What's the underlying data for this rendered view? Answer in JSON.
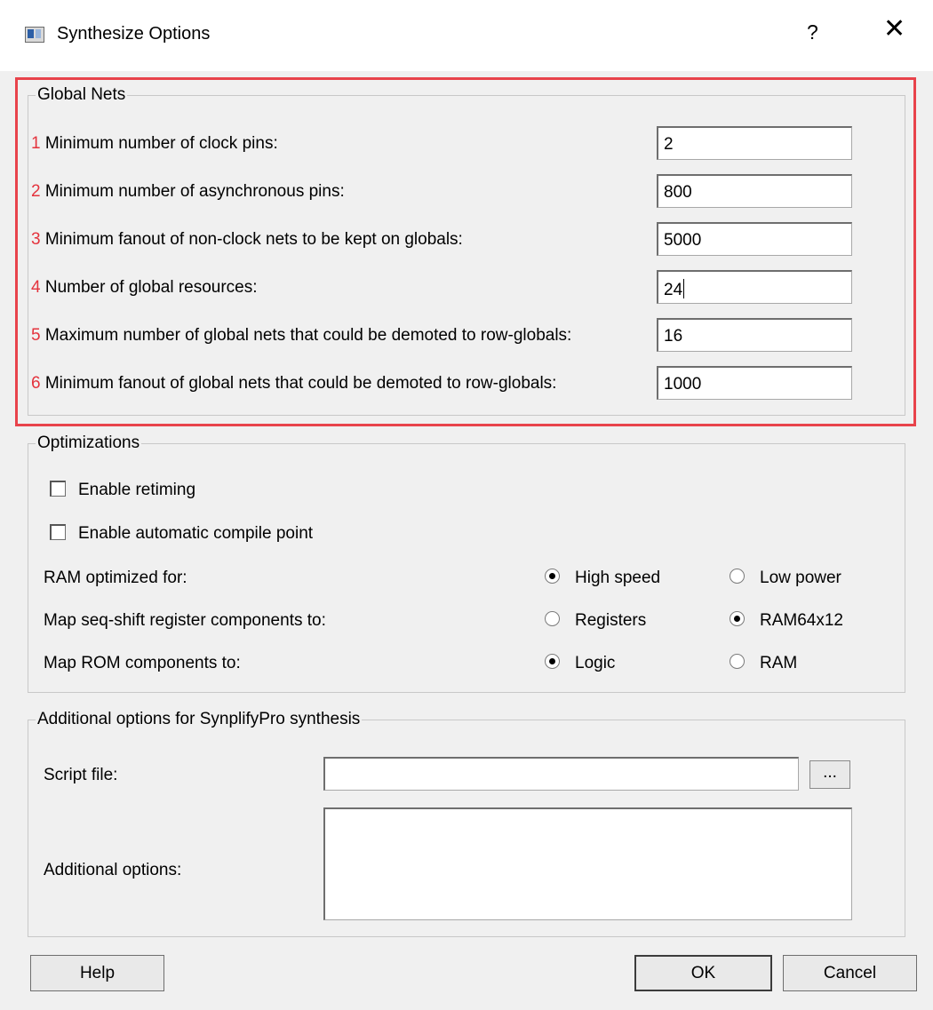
{
  "window": {
    "title": "Synthesize Options",
    "help_icon": "?",
    "close_icon": "✕"
  },
  "global_nets": {
    "legend": "Global Nets",
    "rows": [
      {
        "num": "1",
        "label": "Minimum number of clock pins:",
        "value": "2"
      },
      {
        "num": "2",
        "label": "Minimum number of asynchronous pins:",
        "value": "800"
      },
      {
        "num": "3",
        "label": "Minimum fanout of non-clock nets to be kept on globals:",
        "value": "5000"
      },
      {
        "num": "4",
        "label": "Number of global resources:",
        "value": "24"
      },
      {
        "num": "5",
        "label": "Maximum number of global nets that could be demoted to row-globals:",
        "value": "16"
      },
      {
        "num": "6",
        "label": "Minimum fanout of global nets that could be demoted to row-globals:",
        "value": "1000"
      }
    ]
  },
  "optimizations": {
    "legend": "Optimizations",
    "enable_retiming": {
      "label": "Enable retiming",
      "checked": false
    },
    "enable_compile_point": {
      "label": "Enable automatic compile point",
      "checked": false
    },
    "ram_optimized": {
      "label": "RAM optimized for:",
      "opt1": "High speed",
      "opt2": "Low power",
      "selected": "High speed"
    },
    "seq_shift": {
      "label": "Map seq-shift register components to:",
      "opt1": "Registers",
      "opt2": "RAM64x12",
      "selected": "RAM64x12"
    },
    "rom": {
      "label": "Map ROM components to:",
      "opt1": "Logic",
      "opt2": "RAM",
      "selected": "Logic"
    }
  },
  "additional": {
    "legend": "Additional options for SynplifyPro synthesis",
    "script_label": "Script file:",
    "script_value": "",
    "browse_label": "...",
    "options_label": "Additional options:",
    "options_value": ""
  },
  "buttons": {
    "help": "Help",
    "ok": "OK",
    "cancel": "Cancel"
  },
  "colors": {
    "highlight": "#e8434b",
    "row_number": "#e4333d"
  }
}
